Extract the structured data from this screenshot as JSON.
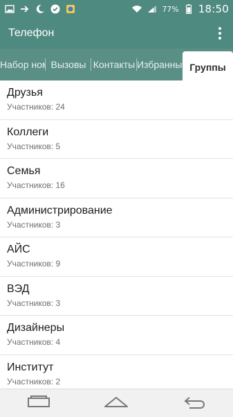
{
  "status_bar": {
    "battery_percent": "77%",
    "time": "18:50",
    "icons": [
      "image-icon",
      "arrow-right-icon",
      "moon-icon",
      "check-icon",
      "app-icon",
      "wifi-icon",
      "signal-icon",
      "battery-icon"
    ]
  },
  "app_bar": {
    "title": "Телефон",
    "menu_icon": "overflow-menu-icon"
  },
  "tabs": [
    {
      "label": "Набор номера",
      "active": false
    },
    {
      "label": "Вызовы",
      "active": false
    },
    {
      "label": "Контакты",
      "active": false
    },
    {
      "label": "Избранные",
      "active": false
    },
    {
      "label": "Группы",
      "active": true
    }
  ],
  "groups": [
    {
      "name": "Друзья",
      "members": "Участников: 24"
    },
    {
      "name": "Коллеги",
      "members": "Участников: 5"
    },
    {
      "name": "Семья",
      "members": "Участников: 16"
    },
    {
      "name": "Администрирование",
      "members": "Участников: 3"
    },
    {
      "name": "АЙС",
      "members": "Участников: 9"
    },
    {
      "name": "ВЭД",
      "members": "Участников: 3"
    },
    {
      "name": "Дизайнеры",
      "members": "Участников: 4"
    },
    {
      "name": "Институт",
      "members": "Участников: 2"
    }
  ],
  "nav_bar": {
    "icons": [
      "recent-apps-icon",
      "home-icon",
      "back-icon"
    ]
  },
  "colors": {
    "primary": "#4f8a80",
    "tab_bg": "#5a8f86"
  }
}
